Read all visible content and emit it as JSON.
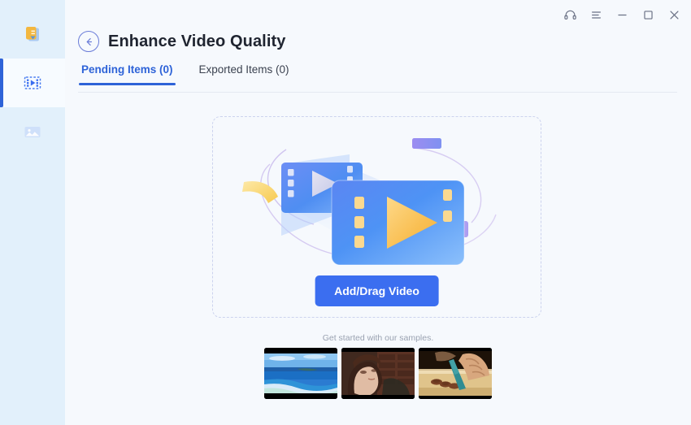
{
  "window": {
    "controls": [
      {
        "name": "support-headset",
        "label": "Support",
        "icon": "headset-icon"
      },
      {
        "name": "menu",
        "label": "Menu",
        "icon": "hamburger-menu-icon"
      },
      {
        "name": "minimize",
        "label": "Minimize",
        "icon": "minimize-icon"
      },
      {
        "name": "maximize",
        "label": "Maximize",
        "icon": "maximize-icon"
      },
      {
        "name": "close",
        "label": "Close",
        "icon": "close-icon"
      }
    ]
  },
  "sidebar": {
    "items": [
      {
        "icon": "toolbox-cards-icon",
        "label": "Toolbox",
        "active": false
      },
      {
        "icon": "video-film-play-icon",
        "label": "Video",
        "active": true
      },
      {
        "icon": "image-photo-icon",
        "label": "Image",
        "active": false
      }
    ]
  },
  "header": {
    "back_label": "Back",
    "title": "Enhance Video Quality"
  },
  "tabs": [
    {
      "label": "Pending Items (0)",
      "active": true
    },
    {
      "label": "Exported Items (0)",
      "active": false
    }
  ],
  "dropzone": {
    "illustration": "video-film-strips-illustration",
    "button_label": "Add/Drag Video"
  },
  "samples": {
    "caption": "Get started with our samples.",
    "items": [
      {
        "name": "sample-beach",
        "alt": "Beach and ocean waves"
      },
      {
        "name": "sample-portrait",
        "alt": "Portrait of a woman by a brick wall"
      },
      {
        "name": "sample-cutting-board",
        "alt": "Hands slicing food with a teal knife"
      }
    ]
  },
  "colors": {
    "accent": "#2e63d8",
    "button": "#3b6ef0",
    "sidebar_bg": "#e2f0fb",
    "main_bg": "#f6f9fd",
    "dropzone_border": "#ccd3ee",
    "title_text": "#1f2430",
    "muted_text": "#9aa2b1"
  }
}
